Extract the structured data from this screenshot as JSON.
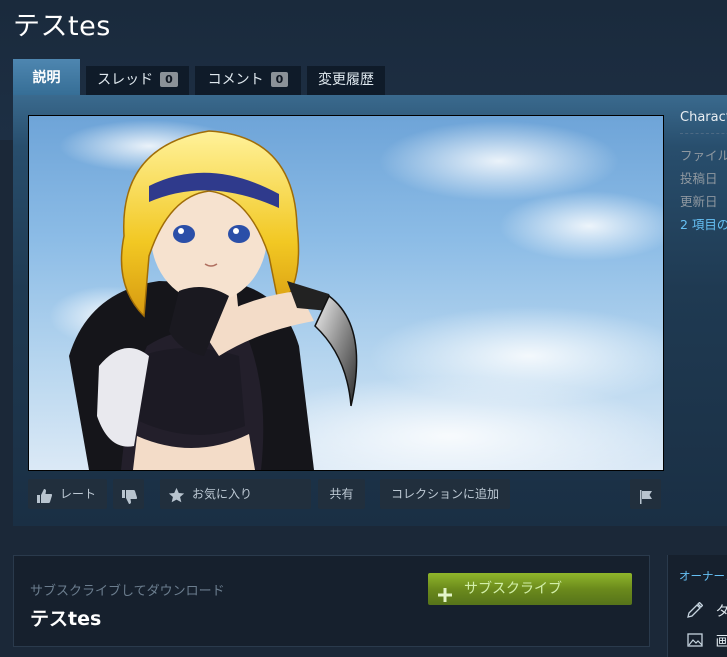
{
  "page": {
    "title": "テスtes"
  },
  "tabs": [
    {
      "label": "説明",
      "active": true
    },
    {
      "label": "スレッド",
      "count": "0"
    },
    {
      "label": "コメント",
      "count": "0"
    },
    {
      "label": "変更履歴"
    }
  ],
  "preview": {
    "image": "anime-girl-with-knife-sky-background"
  },
  "actions": {
    "rate_label": "レート",
    "favorite_label": "お気に入り",
    "share_label": "共有",
    "collection_label": "コレクションに追加"
  },
  "details": {
    "category": "Charact",
    "file_size_label": "ファイル",
    "posted_label": "投稿日",
    "updated_label": "更新日",
    "items_link": "2 項目の"
  },
  "subscribe": {
    "hint": "サブスクライブしてダウンロード",
    "title": "テスtes",
    "button_label": "サブスクライブ"
  },
  "owner": {
    "title": "オーナーコ",
    "items": [
      {
        "label": "タ",
        "icon": "pencil-icon"
      },
      {
        "label": "画",
        "icon": "image-icon"
      }
    ]
  },
  "colors": {
    "accent": "#66c0f4",
    "subscribe_green": "#75a12a",
    "background": "#1b2838"
  }
}
